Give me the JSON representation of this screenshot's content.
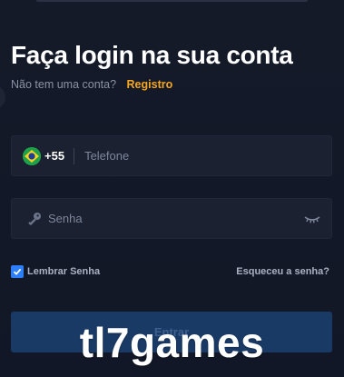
{
  "header": {
    "title": "Faça login na sua conta",
    "no_account_text": "Não tem uma conta?",
    "register_link": "Registro"
  },
  "phone_field": {
    "country_flag": "brazil-flag-icon",
    "dial_code": "+55",
    "placeholder": "Telefone",
    "value": ""
  },
  "password_field": {
    "icon": "key-icon",
    "placeholder": "Senha",
    "value": "",
    "toggle_icon": "eye-closed-icon"
  },
  "remember": {
    "label": "Lembrar Senha",
    "checked": true
  },
  "forgot_link": "Esqueceu a senha?",
  "submit_button": "Entrar",
  "watermark": "tl7games",
  "colors": {
    "background": "#121826",
    "field_bg": "#1b2131",
    "accent": "#f5a623",
    "checkbox": "#2d7ff9",
    "button_bg": "#1a3a66"
  }
}
